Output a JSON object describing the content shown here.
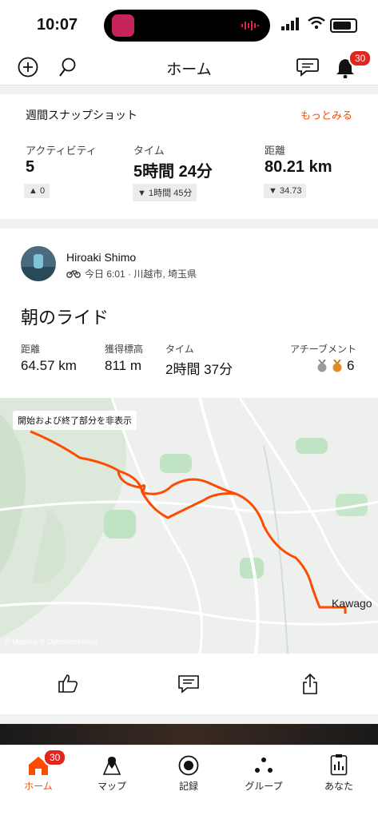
{
  "status_bar": {
    "time": "10:07"
  },
  "header": {
    "title": "ホーム",
    "notification_count": "30"
  },
  "snapshot": {
    "title": "週間スナップショット",
    "more": "もっとみる",
    "stats": [
      {
        "label": "アクティビティ",
        "value": "5",
        "delta": "0",
        "trend": "up"
      },
      {
        "label": "タイム",
        "value": "5時間 24分",
        "delta": "1時間 45分",
        "trend": "down"
      },
      {
        "label": "距離",
        "value": "80.21 km",
        "delta": "34.73",
        "trend": "down"
      }
    ]
  },
  "activity": {
    "athlete": "Hiroaki Shimo",
    "meta": "今日 6:01 · 川越市, 埼玉県",
    "title": "朝のライド",
    "stats": [
      {
        "label": "距離",
        "value": "64.57 km"
      },
      {
        "label": "獲得標高",
        "value": "811 m"
      },
      {
        "label": "タイム",
        "value": "2時間 37分"
      }
    ],
    "achievements_label": "アチーブメント",
    "achievements_count": "6",
    "map_overlay_label": "開始および終了部分を非表示",
    "map_place_label": "Kawago",
    "map_attribution": "© Mapbox © OpenStreetMap"
  },
  "tabbar": {
    "badge": "30",
    "items": [
      {
        "label": "ホーム"
      },
      {
        "label": "マップ"
      },
      {
        "label": "記録"
      },
      {
        "label": "グループ"
      },
      {
        "label": "あなた"
      }
    ]
  },
  "colors": {
    "accent": "#fc4c02",
    "badge": "#e0261e"
  }
}
